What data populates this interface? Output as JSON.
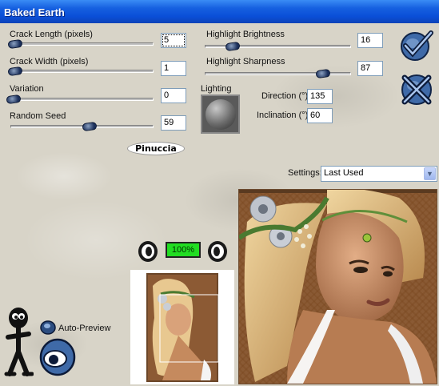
{
  "window": {
    "title": "Baked Earth"
  },
  "controls": {
    "crack_length": {
      "label": "Crack Length (pixels)",
      "value": "5"
    },
    "crack_width": {
      "label": "Crack Width (pixels)",
      "value": "1"
    },
    "variation": {
      "label": "Variation",
      "value": "0"
    },
    "random_seed": {
      "label": "Random Seed",
      "value": "59"
    },
    "highlight_brightness": {
      "label": "Highlight Brightness",
      "value": "16"
    },
    "highlight_sharpness": {
      "label": "Highlight Sharpness",
      "value": "87"
    },
    "lighting": {
      "label": "Lighting"
    },
    "direction": {
      "label": "Direction (°)",
      "value": "135"
    },
    "inclination": {
      "label": "Inclination (°)",
      "value": "60"
    }
  },
  "watermark": "Pinuccia",
  "settings": {
    "label": "Settings:",
    "selected": "Last Used"
  },
  "preview": {
    "zoom": "100%",
    "auto_preview_label": "Auto-Preview"
  },
  "colors": {
    "titlebar": "#0a4fd8",
    "zoom_readout": "#22dd22"
  }
}
